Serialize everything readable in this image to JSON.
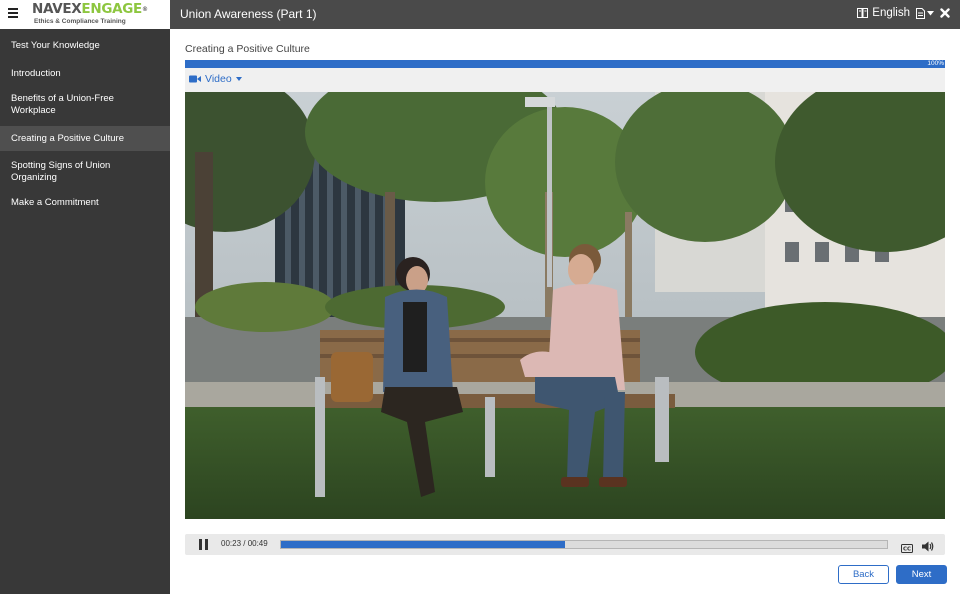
{
  "brand": {
    "name_part1": "NAVEX",
    "name_part2": "ENGAGE",
    "tagline": "Ethics & Compliance Training",
    "trademark": "®"
  },
  "header": {
    "course_title": "Union Awareness (Part 1)",
    "language": "English"
  },
  "sidebar": {
    "items": [
      {
        "label": "Test Your Knowledge",
        "active": false
      },
      {
        "label": "Introduction",
        "active": false
      },
      {
        "label": "Benefits of a Union-Free Workplace",
        "active": false
      },
      {
        "label": "Creating a Positive Culture",
        "active": true
      },
      {
        "label": "Spotting Signs of Union Organizing",
        "active": false
      },
      {
        "label": "Make a Commitment",
        "active": false
      }
    ]
  },
  "main": {
    "section_title": "Creating a Positive Culture",
    "progress": {
      "label": "100%",
      "value": 1.0
    },
    "media_type_label": "Video"
  },
  "player": {
    "time_label": "00:23 / 00:49",
    "played_fraction": 0.4694,
    "cc_label": "CC"
  },
  "footer": {
    "back_label": "Back",
    "next_label": "Next"
  },
  "colors": {
    "accent": "#2e6dc7",
    "sidebar_bg": "#383838",
    "topbar_bg": "#4a4a4a",
    "logo_green": "#8dc63f"
  },
  "icons": [
    "hamburger-icon",
    "language-icon",
    "document-icon",
    "caret-down-icon",
    "close-icon",
    "video-camera-icon",
    "pause-icon",
    "closed-caption-icon",
    "volume-icon"
  ]
}
